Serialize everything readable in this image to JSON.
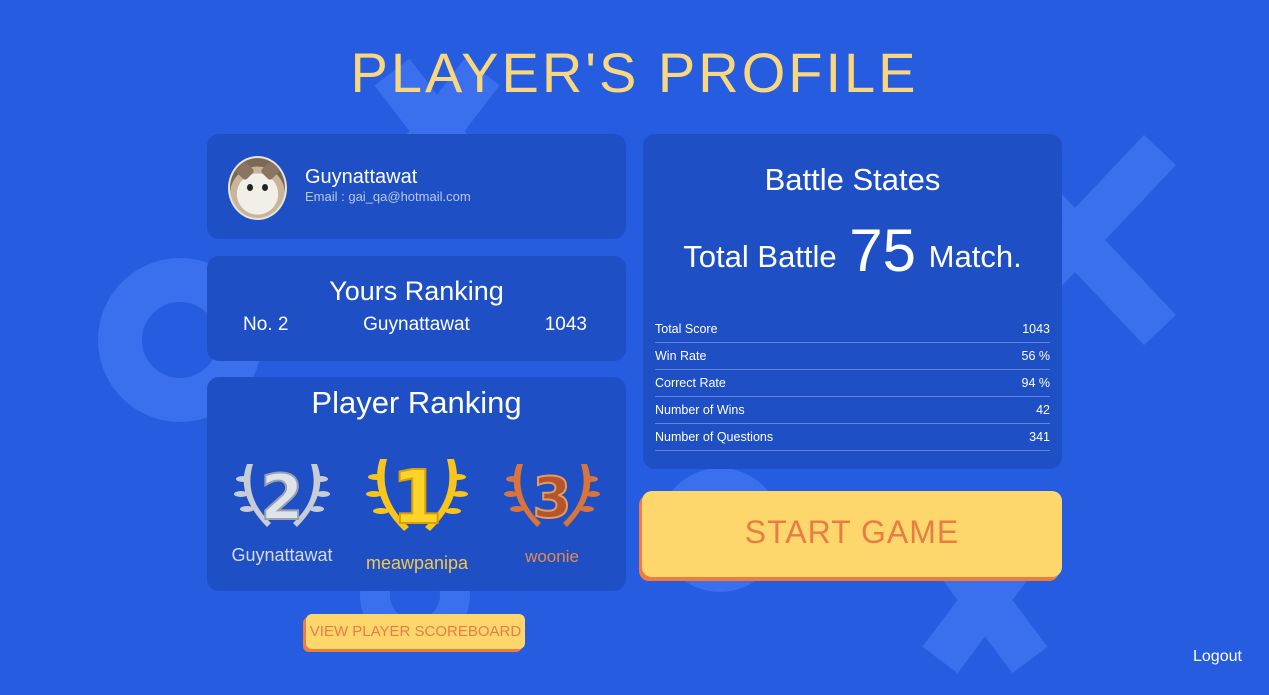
{
  "title": "PLAYER'S PROFILE",
  "profile": {
    "name": "Guynattawat",
    "email": "Email : gai_qa@hotmail.com"
  },
  "yours_ranking": {
    "title": "Yours Ranking",
    "rank": "No. 2",
    "name": "Guynattawat",
    "score": "1043"
  },
  "player_ranking": {
    "title": "Player Ranking",
    "medals": [
      {
        "place": 2,
        "name": "Guynattawat",
        "color": "#c7ccd6"
      },
      {
        "place": 1,
        "name": "meawpanipa",
        "color": "#f7c51c"
      },
      {
        "place": 3,
        "name": "woonie",
        "color": "#d9743a"
      }
    ]
  },
  "battle": {
    "title": "Battle States",
    "total_prefix": "Total Battle",
    "total_value": "75",
    "total_suffix": "Match.",
    "stats": [
      {
        "label": "Total Score",
        "value": "1043"
      },
      {
        "label": "Win Rate",
        "value": "56 %"
      },
      {
        "label": "Correct Rate",
        "value": "94 %"
      },
      {
        "label": "Number of Wins",
        "value": "42"
      },
      {
        "label": "Number of Questions",
        "value": "341"
      }
    ]
  },
  "buttons": {
    "start": "START GAME",
    "scoreboard": "VIEW PLAYER SCOREBOARD",
    "logout": "Logout"
  },
  "colors": {
    "background": "#265ce0",
    "card": "#1f4fc4",
    "accent_yellow": "#fdd76c",
    "accent_orange": "#e87c45",
    "title": "#f9d77e"
  }
}
